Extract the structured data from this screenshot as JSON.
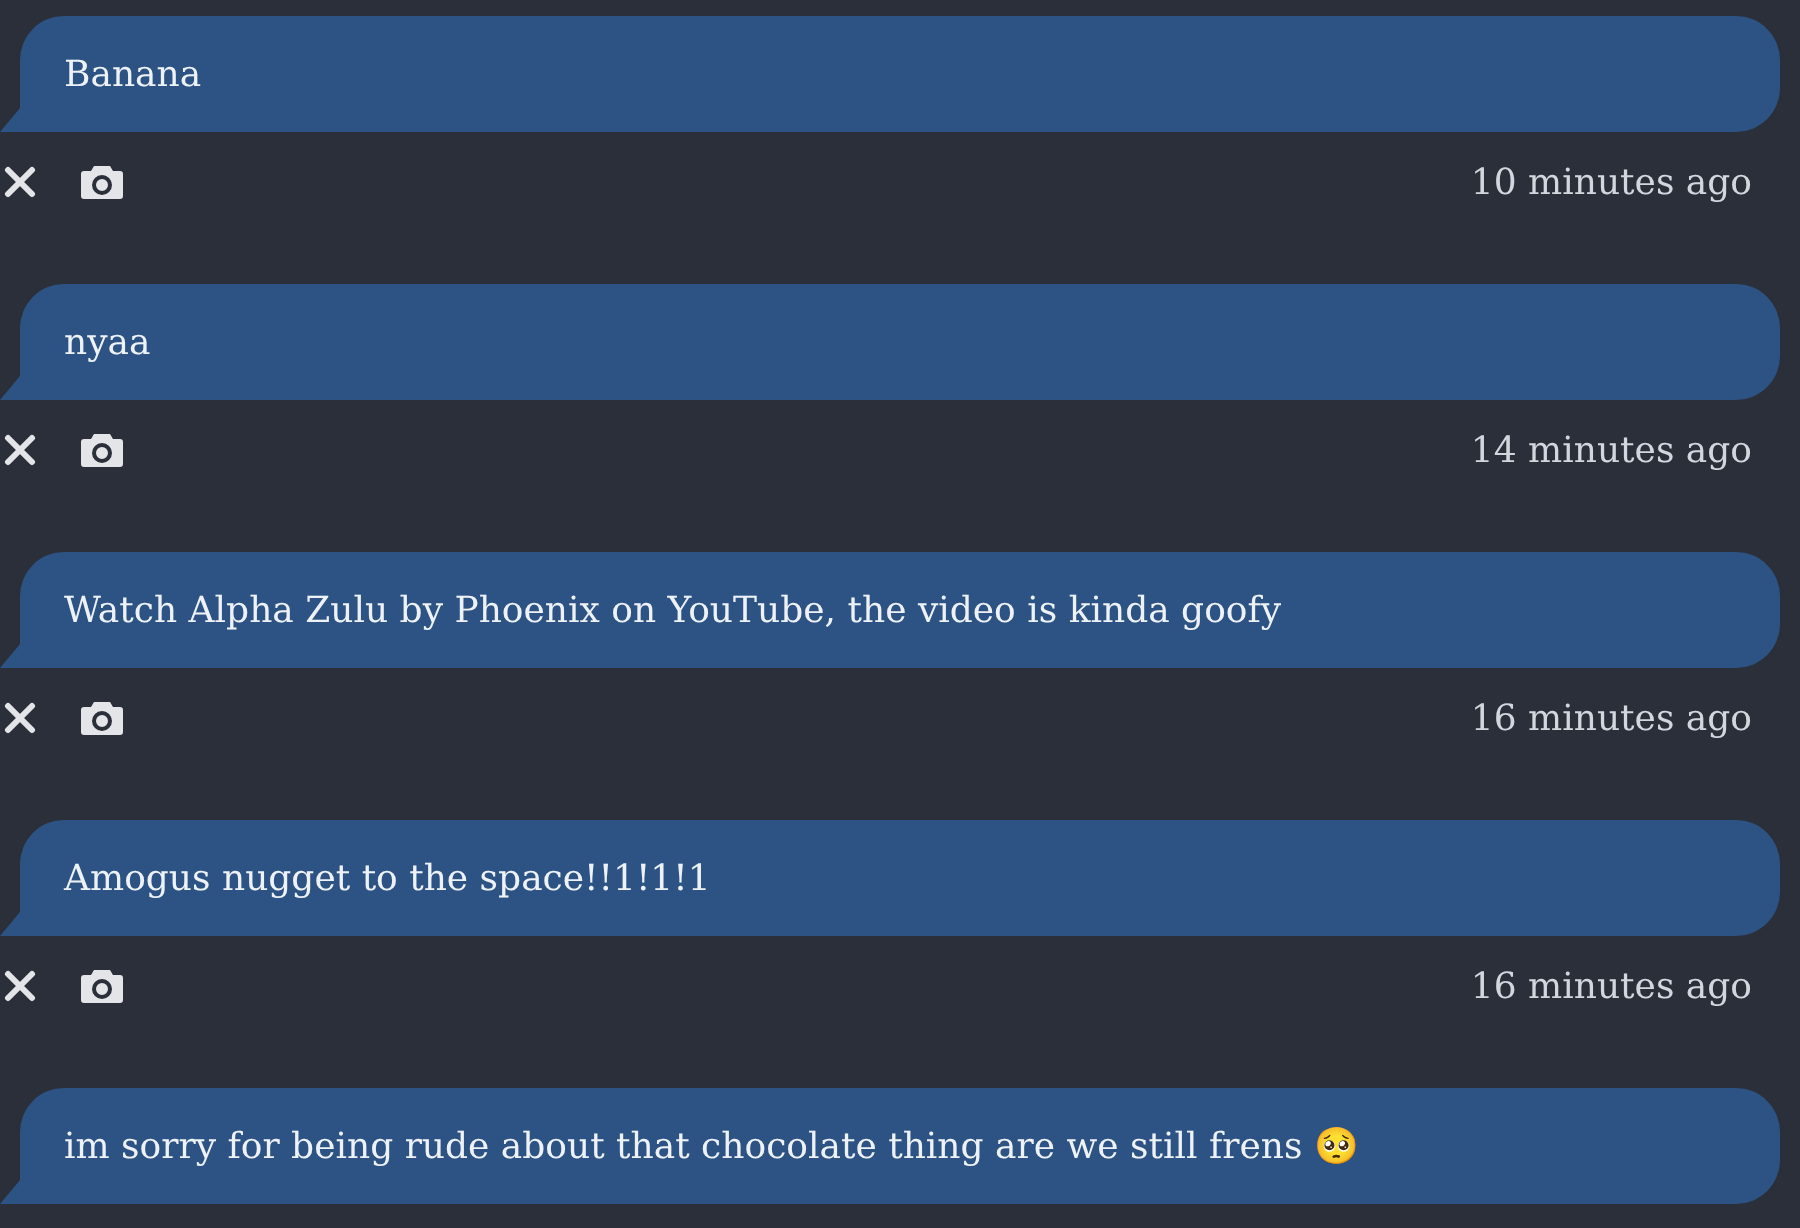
{
  "messages": [
    {
      "text": "Banana",
      "time": "10 minutes ago"
    },
    {
      "text": "nyaa",
      "time": "14 minutes ago"
    },
    {
      "text": "Watch Alpha Zulu by Phoenix on YouTube, the video is kinda goofy",
      "time": "16 minutes ago"
    },
    {
      "text": "Amogus nugget to the space!!1!1!1",
      "time": "16 minutes ago"
    },
    {
      "text": "im sorry for being rude about that chocolate thing are we still frens 🥺"
    }
  ]
}
